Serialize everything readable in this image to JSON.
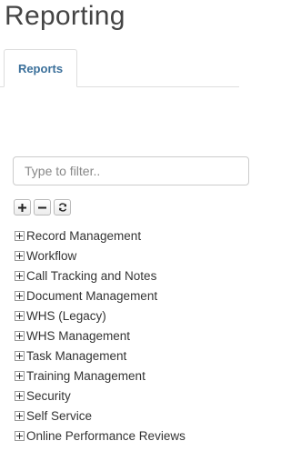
{
  "header": {
    "title": "Reporting"
  },
  "tabs": [
    {
      "label": "Reports",
      "active": true
    }
  ],
  "filter": {
    "placeholder": "Type to filter..",
    "value": ""
  },
  "toolbar": {
    "expand_all": "plus-icon",
    "collapse_all": "minus-icon",
    "refresh": "refresh-icon"
  },
  "tree": {
    "items": [
      {
        "label": "Record Management"
      },
      {
        "label": "Workflow"
      },
      {
        "label": "Call Tracking and Notes"
      },
      {
        "label": "Document Management"
      },
      {
        "label": "WHS (Legacy)"
      },
      {
        "label": "WHS Management"
      },
      {
        "label": "Task Management"
      },
      {
        "label": "Training Management"
      },
      {
        "label": "Security"
      },
      {
        "label": "Self Service"
      },
      {
        "label": "Online Performance Reviews"
      }
    ]
  },
  "colors": {
    "tab_text": "#3a6f9a",
    "border": "#dddddd"
  }
}
